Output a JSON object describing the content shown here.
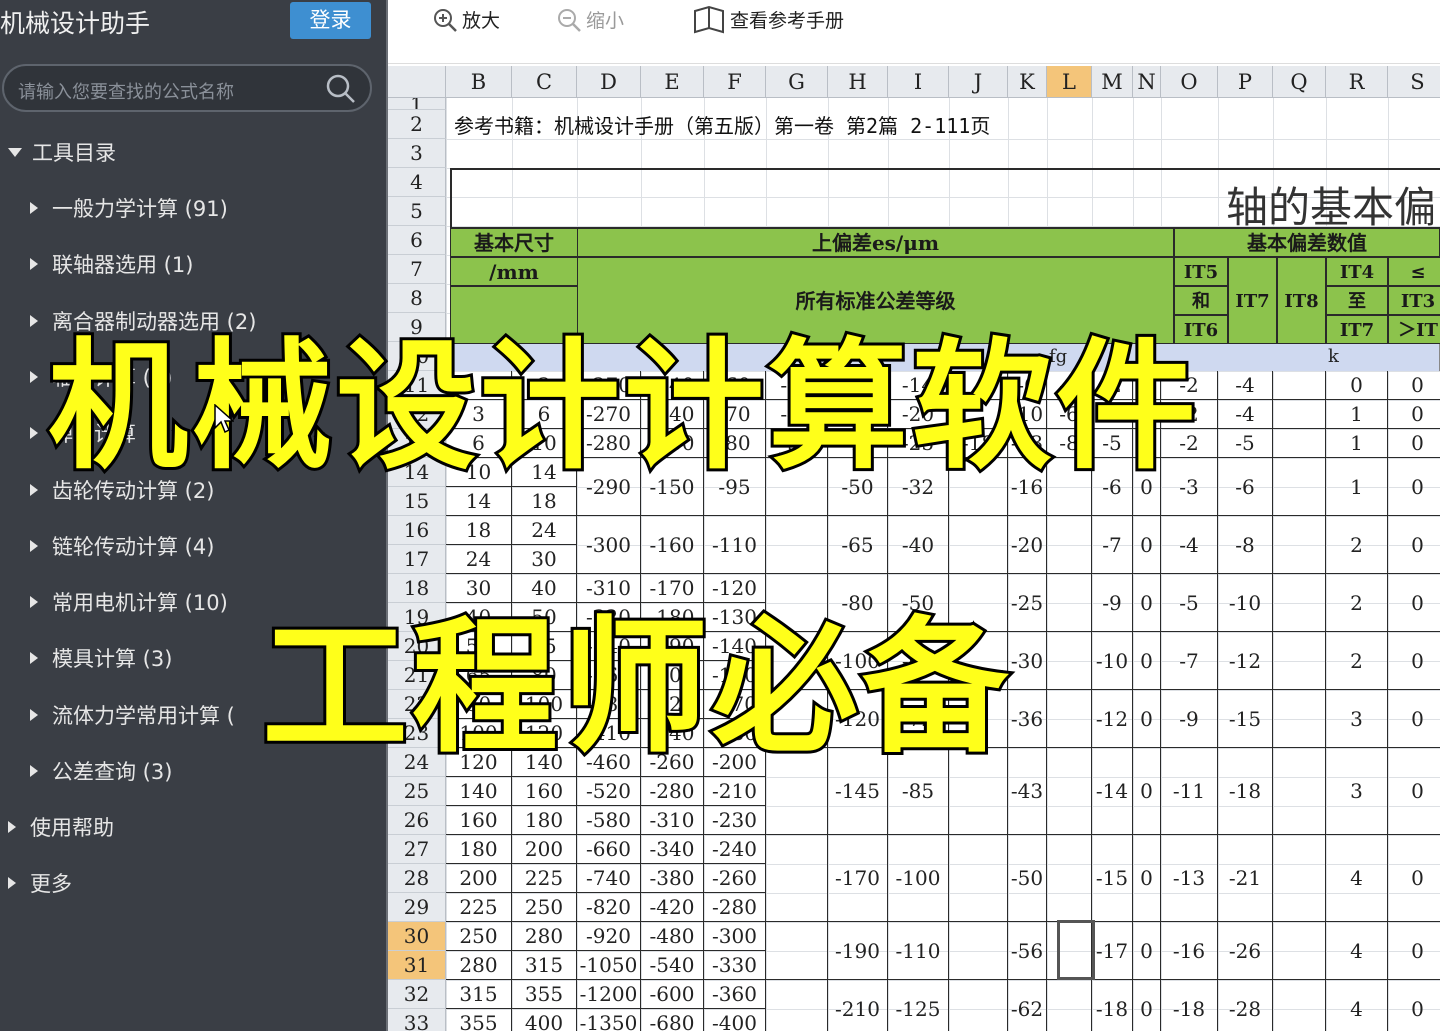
{
  "app": {
    "title": "机械设计助手",
    "login": "登录"
  },
  "search": {
    "placeholder": "请输入您要查找的公式名称"
  },
  "tree": {
    "root": "工具目录",
    "items": [
      "一般力学计算 (91)",
      "联轴器选用 (1)",
      "离合器制动器选用 (2)",
      "轴承计算 (3)",
      "弹簧计算",
      "齿轮传动计算 (2)",
      "链轮传动计算 (4)",
      "常用电机计算 (10)",
      "模具计算 (3)",
      "流体力学常用计算 (",
      "公差查询 (3)"
    ],
    "help": "使用帮助",
    "more": "更多"
  },
  "toolbar": {
    "zoom_in": "放大",
    "zoom_out": "缩小",
    "manual": "查看参考手册"
  },
  "sheet": {
    "columns": [
      "B",
      "C",
      "D",
      "E",
      "F",
      "G",
      "H",
      "I",
      "J",
      "K",
      "L",
      "M",
      "N",
      "O",
      "P",
      "Q",
      "R",
      "S"
    ],
    "rows": [
      "1",
      "2",
      "3",
      "4",
      "5",
      "6",
      "7",
      "8",
      "9",
      "10",
      "11",
      "12",
      "13",
      "14",
      "15",
      "16",
      "17",
      "18",
      "19",
      "20",
      "21",
      "22",
      "23",
      "24",
      "25",
      "26",
      "27",
      "28",
      "29",
      "30",
      "31",
      "32",
      "33"
    ],
    "reference": "参考书籍：机械设计手册（第五版）第一卷 第2篇 2-111页",
    "title": "轴的基本偏",
    "hdr_size": "基本尺寸",
    "hdr_mm": "/mm",
    "hdr_upper": "上偏差es/μm",
    "hdr_basic": "基本偏差数值",
    "hdr_all": "所有标准公差等级",
    "hdr_it5": "IT5",
    "hdr_and": "和",
    "hdr_it6": "IT6",
    "hdr_it7": "IT7",
    "hdr_it8": "IT8",
    "hdr_it4": "IT4",
    "hdr_to": "至",
    "hdr_it7b": "IT7",
    "hdr_le": "≤",
    "hdr_it3": "IT3",
    "hdr_gt": "＞IT",
    "sub_fg": "fg",
    "sub_k": "k",
    "data_rows": [
      {
        "b": "",
        "c": "3",
        "d": "-270",
        "e": "-140",
        "f": "-60",
        "g": "-34",
        "h": "-20",
        "i": "-14",
        "k": "-6",
        "l": "-4",
        "m": "-2",
        "n": "0",
        "o": "-2",
        "p": "-4",
        "r": "0",
        "s": "0"
      },
      {
        "b": "3",
        "c": "6",
        "d": "-270",
        "e": "-140",
        "f": "-70",
        "g": "-46",
        "h": "-30",
        "i": "-20",
        "k": "-10",
        "l": "-6",
        "m": "-4",
        "n": "0",
        "o": "-2",
        "p": "-4",
        "r": "1",
        "s": "0"
      },
      {
        "b": "6",
        "c": "10",
        "d": "-280",
        "e": "-150",
        "f": "-80",
        "g": "-56",
        "h": "-40",
        "i": "-25",
        "j": "-18",
        "k": "-13",
        "l": "-8",
        "m": "-5",
        "n": "0",
        "o": "-2",
        "p": "-5",
        "r": "1",
        "s": "0"
      }
    ],
    "merged_rows": [
      {
        "r1": {
          "b": "10",
          "c": "14"
        },
        "r2": {
          "b": "14",
          "c": "18"
        },
        "d": "-290",
        "e": "-150",
        "f": "-95",
        "h": "-50",
        "i": "-32",
        "k": "-16",
        "m": "-6",
        "n": "0",
        "o": "-3",
        "p": "-6",
        "r": "1",
        "s": "0"
      },
      {
        "r1": {
          "b": "18",
          "c": "24"
        },
        "r2": {
          "b": "24",
          "c": "30"
        },
        "d": "-300",
        "e": "-160",
        "f": "-110",
        "h": "-65",
        "i": "-40",
        "k": "-20",
        "m": "-7",
        "n": "0",
        "o": "-4",
        "p": "-8",
        "r": "2",
        "s": "0"
      },
      {
        "r1": {
          "b": "30",
          "c": "40",
          "d": "-310",
          "e": "-170",
          "f": "-120"
        },
        "r2": {
          "b": "40",
          "c": "50",
          "d": "-320",
          "e": "-180",
          "f": "-130"
        },
        "h": "-80",
        "i": "-50",
        "k": "-25",
        "m": "-9",
        "n": "0",
        "o": "-5",
        "p": "-10",
        "r": "2",
        "s": "0"
      },
      {
        "r1": {
          "b": "50",
          "c": "65",
          "d": "-340",
          "e": "-190",
          "f": "-140"
        },
        "r2": {
          "b": "65",
          "c": "80",
          "d": "-360",
          "e": "-200",
          "f": "-150"
        },
        "h": "-100",
        "i": "-60",
        "k": "-30",
        "m": "-10",
        "n": "0",
        "o": "-7",
        "p": "-12",
        "r": "2",
        "s": "0"
      },
      {
        "r1": {
          "b": "80",
          "c": "100",
          "d": "-380",
          "e": "-220",
          "f": "-170"
        },
        "r2": {
          "b": "100",
          "c": "120",
          "d": "-410",
          "e": "-240",
          "f": "-180"
        },
        "h": "-120",
        "i": "-72",
        "k": "-36",
        "m": "-12",
        "n": "0",
        "o": "-9",
        "p": "-15",
        "r": "3",
        "s": "0"
      }
    ],
    "triple_row": {
      "rows": [
        {
          "b": "120",
          "c": "140",
          "d": "-460",
          "e": "-260",
          "f": "-200"
        },
        {
          "b": "140",
          "c": "160",
          "d": "-520",
          "e": "-280",
          "f": "-210"
        },
        {
          "b": "160",
          "c": "180",
          "d": "-580",
          "e": "-310",
          "f": "-230"
        }
      ],
      "h": "-145",
      "i": "-85",
      "k": "-43",
      "m": "-14",
      "n": "0",
      "o": "-11",
      "p": "-18",
      "r": "3",
      "s": "0"
    },
    "triple_row2": {
      "rows": [
        {
          "b": "180",
          "c": "200",
          "d": "-660",
          "e": "-340",
          "f": "-240"
        },
        {
          "b": "200",
          "c": "225",
          "d": "-740",
          "e": "-380",
          "f": "-260"
        },
        {
          "b": "225",
          "c": "250",
          "d": "-820",
          "e": "-420",
          "f": "-280"
        }
      ],
      "h": "-170",
      "i": "-100",
      "k": "-50",
      "m": "-15",
      "n": "0",
      "o": "-13",
      "p": "-21",
      "r": "4",
      "s": "0"
    },
    "pair_row": {
      "rows": [
        {
          "b": "250",
          "c": "280",
          "d": "-920",
          "e": "-480",
          "f": "-300"
        },
        {
          "b": "280",
          "c": "315",
          "d": "-1050",
          "e": "-540",
          "f": "-330"
        }
      ],
      "h": "-190",
      "i": "-110",
      "k": "-56",
      "m": "-17",
      "n": "0",
      "o": "-16",
      "p": "-26",
      "r": "4",
      "s": "0"
    },
    "pair_row2": {
      "rows": [
        {
          "b": "315",
          "c": "355",
          "d": "-1200",
          "e": "-600",
          "f": "-360"
        },
        {
          "b": "355",
          "c": "400",
          "d": "-1350",
          "e": "-680",
          "f": "-400"
        }
      ],
      "h": "-210",
      "i": "-125",
      "k": "-62",
      "m": "-18",
      "n": "0",
      "o": "-18",
      "p": "-28",
      "r": "4",
      "s": "0"
    }
  },
  "overlay": {
    "line1": "机械设计计算软件",
    "line2": "工程师必备"
  },
  "colors": {
    "sidebar": "#3a3e45",
    "accent": "#3e8fd1",
    "green": "#8cc34c",
    "overlay": "#ffff1a",
    "selected_header": "#f4c57a"
  }
}
